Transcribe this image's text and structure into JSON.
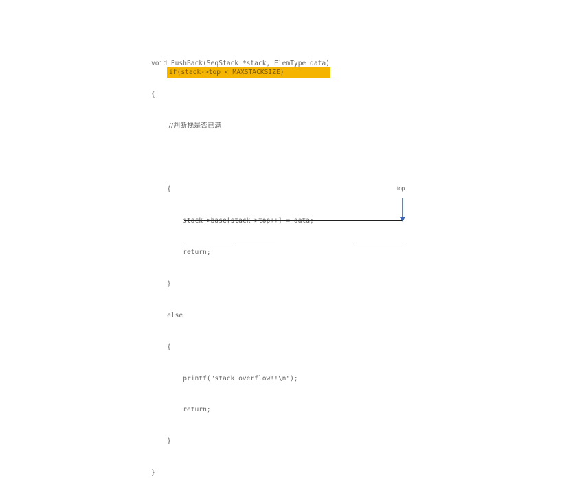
{
  "code": {
    "lines": [
      "void PushBack(SeqStack *stack, ElemType data)",
      "{",
      "        //判断栈是否已满",
      "",
      "    {",
      "        stack->base[stack->top++] = data;",
      "        return;",
      "    }",
      "    else",
      "    {",
      "        printf(\"stack overflow!!\\n\");",
      "        return;",
      "    }",
      "}"
    ],
    "highlighted_line": "if(stack->top < MAXSTACKSIZE)"
  },
  "diagram": {
    "top_label": "top",
    "highlight_color": "#f5b400",
    "arrow_color": "#3b64b4"
  }
}
